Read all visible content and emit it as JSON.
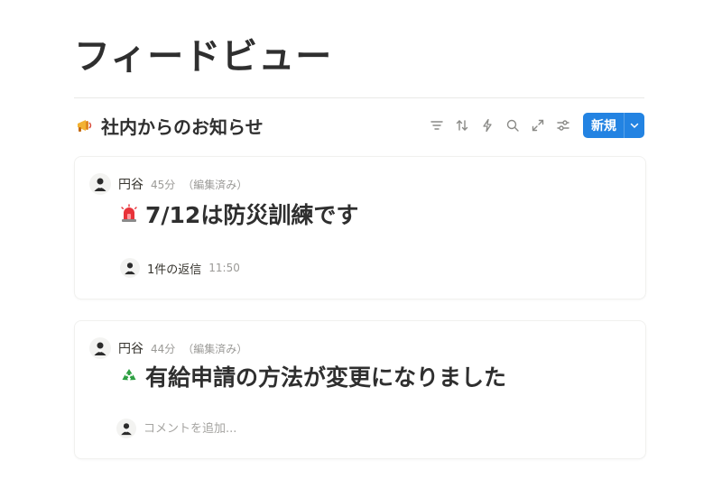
{
  "page": {
    "title": "フィードビュー"
  },
  "database": {
    "icon": "megaphone-icon",
    "title": "社内からのお知らせ",
    "toolbar": {
      "icons": [
        "filter-icon",
        "sort-icon",
        "lightning-icon",
        "search-icon",
        "expand-icon",
        "settings-sliders-icon"
      ],
      "new_label": "新規"
    }
  },
  "posts": [
    {
      "author": "円谷",
      "time": "45分",
      "edited": "（編集済み）",
      "emoji": "rotating-light-icon",
      "title": "7/12は防災訓練です",
      "reply_count": "1件の返信",
      "reply_time": "11:50"
    },
    {
      "author": "円谷",
      "time": "44分",
      "edited": "（編集済み）",
      "emoji": "recycle-icon",
      "title": "有給申請の方法が変更になりました",
      "comment_placeholder": "コメントを追加..."
    }
  ],
  "colors": {
    "accent": "#2383e2",
    "text": "#37352f",
    "muted": "#9b9a97"
  }
}
